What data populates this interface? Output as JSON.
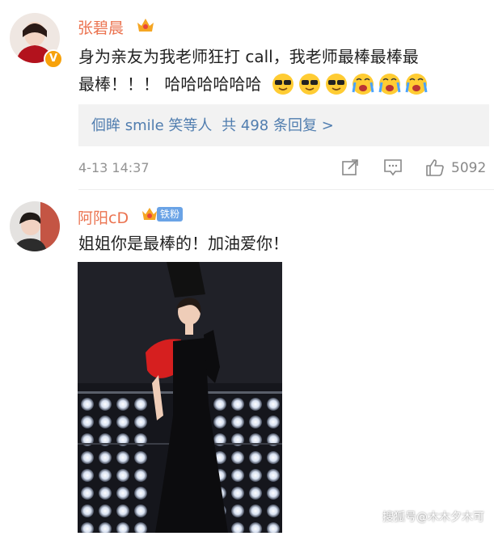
{
  "comment1": {
    "author": "张碧晨",
    "line1": "身为亲友为我老师狂打 call，我老师最棒最棒最",
    "line2": "最棒！！！ 哈哈哈哈哈哈",
    "replies_users": "佪眸 smile 笑等人",
    "replies_count": "共 498 条回复 >",
    "date": "4-13 14:37",
    "likes": "5092"
  },
  "comment2": {
    "author": "阿阳cD",
    "badge": "铁粉",
    "text": "姐姐你是最棒的！加油爱你！"
  },
  "watermark": "搜狐号@木木夕木可",
  "colors": {
    "name": "#eb7350",
    "link": "#507daf",
    "reply_bg": "#f2f2f2",
    "meta": "#939393"
  }
}
